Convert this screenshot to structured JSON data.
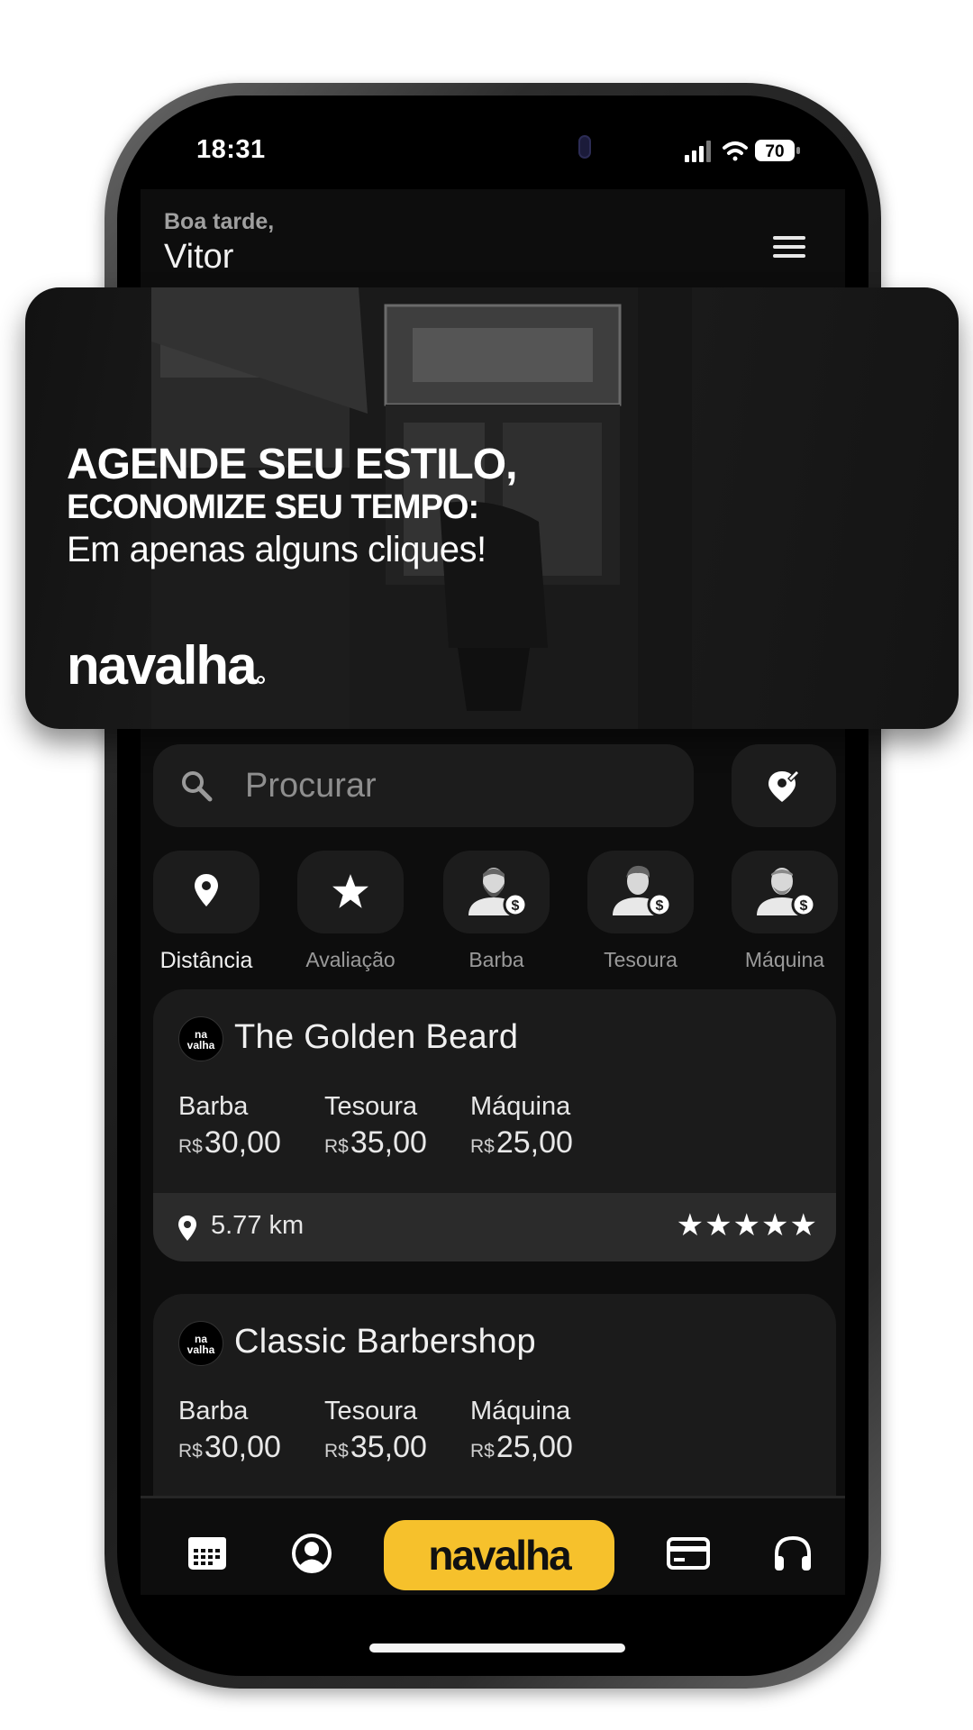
{
  "status_bar": {
    "time": "18:31",
    "battery": "70"
  },
  "header": {
    "greeting": "Boa tarde,",
    "user_name": "Vitor"
  },
  "hero": {
    "line1": "AGENDE SEU ESTILO,",
    "line2": "ECONOMIZE SEU TEMPO:",
    "line3": "Em apenas alguns cliques!",
    "logo": "navalha"
  },
  "search": {
    "placeholder": "Procurar"
  },
  "filters": [
    {
      "label": "Distância",
      "icon": "location-pin-icon",
      "active": true
    },
    {
      "label": "Avaliação",
      "icon": "star-icon",
      "active": false
    },
    {
      "label": "Barba",
      "icon": "bearded-man-price-icon",
      "active": false
    },
    {
      "label": "Tesoura",
      "icon": "man-haircut-price-icon",
      "active": false
    },
    {
      "label": "Máquina",
      "icon": "man-clipper-price-icon",
      "active": false
    }
  ],
  "barbershops": [
    {
      "avatar_text": "na\nvalha",
      "name": "The Golden Beard",
      "prices": [
        {
          "service": "Barba",
          "currency": "R$",
          "value": "30,00"
        },
        {
          "service": "Tesoura",
          "currency": "R$",
          "value": "35,00"
        },
        {
          "service": "Máquina",
          "currency": "R$",
          "value": "25,00"
        }
      ],
      "distance": "5.77 km",
      "rating": "★★★★★"
    },
    {
      "avatar_text": "na\nvalha",
      "name": "Classic Barbershop",
      "prices": [
        {
          "service": "Barba",
          "currency": "R$",
          "value": "30,00"
        },
        {
          "service": "Tesoura",
          "currency": "R$",
          "value": "35,00"
        },
        {
          "service": "Máquina",
          "currency": "R$",
          "value": "25,00"
        }
      ]
    }
  ],
  "bottom_nav": {
    "items": [
      "calendar-icon",
      "profile-icon",
      "navalha",
      "card-icon",
      "headset-icon"
    ],
    "center_label": "navalha"
  },
  "colors": {
    "accent": "#F6C12C",
    "background": "#0D0D0D",
    "card": "#1B1B1B",
    "card_footer": "#2B2B2B"
  }
}
